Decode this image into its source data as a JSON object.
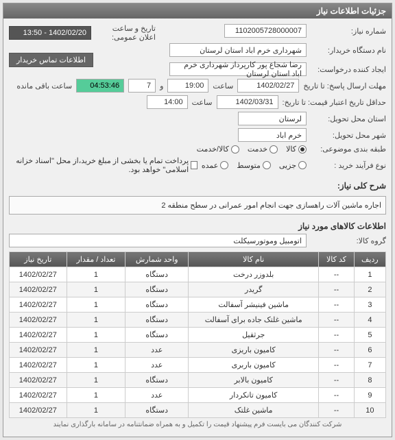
{
  "header": {
    "title": "جزئیات اطلاعات نیاز"
  },
  "left": {
    "need_no_label": "شماره نیاز:",
    "need_no": "1102005728000007",
    "buyer_label": "نام دستگاه خریدار:",
    "buyer": "شهرداری خرم اباد استان لرستان",
    "requester_label": "ایجاد کننده درخواست:",
    "requester": "رضا شجاع پور کارپرداز شهرداری خرم اباد استان لرستان",
    "deadline_label": "مهلت ارسال پاسخ: تا تاریخ",
    "deadline_date": "1402/02/27",
    "time_label": "ساعت",
    "deadline_time": "19:00",
    "and_label": "و",
    "deadline_days": "7",
    "validity_label": "حداقل تاریخ اعتبار قیمت: تا تاریخ:",
    "validity_date": "1402/03/31",
    "validity_time": "14:00",
    "province_label": "استان محل تحویل:",
    "province": "لرستان",
    "city_label": "شهر محل تحویل:",
    "city": "خرم اباد",
    "category_label": "طبقه بندی موضوعی:",
    "buy_type_label": "نوع فرآیند خرید :",
    "pay_note": "پرداخت تمام یا بخشی از مبلغ خرید،از محل \"اسناد خزانه اسلامی\" خواهد بود."
  },
  "right": {
    "announce_label": "تاریخ و ساعت اعلان عمومی:",
    "announce": "1402/02/20 - 13:50",
    "contact_btn": "اطلاعات تماس خریدار",
    "remain_label": "ساعت باقی مانده",
    "remain": "04:53:46"
  },
  "category_options": [
    "کالا",
    "خدمت",
    "کالا/خدمت"
  ],
  "buy_options": [
    "جزیی",
    "متوسط",
    "عمده"
  ],
  "desc": {
    "title": "شرح کلی نیاز:",
    "text": "اجاره ماشین آلات راهسازی جهت انجام امور عمرانی در سطح منطقه 2"
  },
  "items_header": "اطلاعات کالاهای مورد نیاز",
  "group_label": "گروه کالا:",
  "group_value": "اتومبیل وموتورسیکلت",
  "columns": [
    "ردیف",
    "کد کالا",
    "نام کالا",
    "واحد شمارش",
    "تعداد / مقدار",
    "تاریخ نیاز"
  ],
  "rows": [
    {
      "idx": 1,
      "code": "--",
      "name": "بلدوزر درخت",
      "unit": "دستگاه",
      "qty": 1,
      "date": "1402/02/27"
    },
    {
      "idx": 2,
      "code": "--",
      "name": "گریدر",
      "unit": "دستگاه",
      "qty": 1,
      "date": "1402/02/27"
    },
    {
      "idx": 3,
      "code": "--",
      "name": "ماشین فینیشر آسفالت",
      "unit": "دستگاه",
      "qty": 1,
      "date": "1402/02/27"
    },
    {
      "idx": 4,
      "code": "--",
      "name": "ماشین غلتک جاده برای آسفالت",
      "unit": "دستگاه",
      "qty": 1,
      "date": "1402/02/27"
    },
    {
      "idx": 5,
      "code": "--",
      "name": "جرثقیل",
      "unit": "دستگاه",
      "qty": 1,
      "date": "1402/02/27"
    },
    {
      "idx": 6,
      "code": "--",
      "name": "کامیون باریزی",
      "unit": "عدد",
      "qty": 1,
      "date": "1402/02/27"
    },
    {
      "idx": 7,
      "code": "--",
      "name": "کامیون باربری",
      "unit": "عدد",
      "qty": 1,
      "date": "1402/02/27"
    },
    {
      "idx": 8,
      "code": "--",
      "name": "کامیون بالابر",
      "unit": "دستگاه",
      "qty": 1,
      "date": "1402/02/27"
    },
    {
      "idx": 9,
      "code": "--",
      "name": "کامیون تانکردار",
      "unit": "عدد",
      "qty": 1,
      "date": "1402/02/27"
    },
    {
      "idx": 10,
      "code": "--",
      "name": "ماشین غلتک",
      "unit": "دستگاه",
      "qty": 1,
      "date": "1402/02/27"
    }
  ],
  "footer": "شرکت کنندگان می بایست فرم پیشنهاد قیمت را تکمیل و به همراه ضمانتنامه در سامانه بارگذاری نمایند"
}
